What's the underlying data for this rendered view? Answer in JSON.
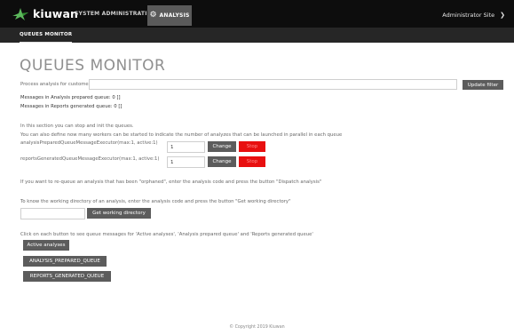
{
  "topbar": {
    "logo_text": "kiuwan",
    "logo_icon": "kiuwan-logo-icon",
    "nav_system_admin": "SYSTEM ADMINISTRATION",
    "nav_analysis": "ANALYSIS",
    "nav_analysis_icon": "gear-icon",
    "admin_label": "Administrator Site",
    "admin_icon": "chevron-down-icon"
  },
  "subnav": {
    "tab": "QUEUES MONITOR"
  },
  "page": {
    "title": "QUEUES MONITOR",
    "process_label": "Process analysis for customers:",
    "process_value": "",
    "update_filter": "Update filter",
    "msg_prepared": "Messages in Analysis prepared queue: 0 []",
    "msg_generated": "Messages in Reports generated queue: 0 []",
    "workers_intro_1": "In this section you can stop and init the queues.",
    "workers_intro_2": "You can also define now many workers can be started to indicate the number of analyzes that can be launched in parallel in each queue",
    "executor1_label": "analysisPreparedQueueMessageExecutor(max:1, active:1)",
    "executor1_value": "1",
    "executor2_label": "reportsGeneratedQueueMessageExecutor(max:1, active:1)",
    "executor2_value": "1",
    "change_label": "Change",
    "stop_label": "Stop",
    "requeue_text": "If you want to re-queue an analysis that has been \"orphaned\", enter the analysis code and press the button \"Dispatch analysis\"",
    "workdir_text": "To know the working directory of an analysis, enter the analysis code and press the button \"Get working directory\"",
    "workdir_value": "",
    "workdir_button": "Get working directory",
    "queue_text": "Click on each button to see queue messages for 'Active analyses', 'Analysis prepared queue' and 'Reports generated queue'",
    "btn_active": "Active analyses",
    "btn_prepared": "ANALYSIS_PREPARED_QUEUE",
    "btn_generated": "REPORTS_GENERATED_QUEUE"
  },
  "footer": {
    "copyright": "© Copyright 2019 Kiuwan"
  },
  "colors": {
    "topbar": "#0d0d0d",
    "subbar": "#262626",
    "button": "#5c5c5c",
    "stop": "#e81010",
    "logo_green": "#4caf50"
  }
}
